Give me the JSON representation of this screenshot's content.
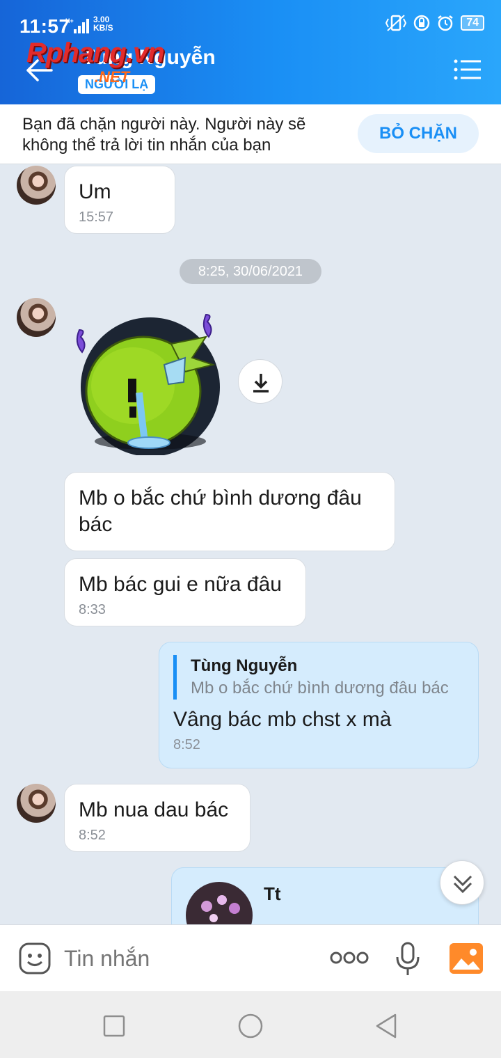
{
  "status_bar": {
    "time": "11:57",
    "network_type": "H+",
    "speed_value": "3.00",
    "speed_unit": "KB/S",
    "battery": "74"
  },
  "header": {
    "watermark_logo": "Rphang.vn",
    "watermark_sub": ".NET",
    "contact_name": "Tùng Nguyễn",
    "stranger_badge": "NGƯỜI LẠ"
  },
  "block_banner": {
    "text": "Bạn đã chặn người này. Người này sẽ không thể trả lời tin nhắn của bạn",
    "unblock_label": "BỎ CHẶN"
  },
  "chat": {
    "date_separator": "8:25, 30/06/2021",
    "messages": [
      {
        "text": "Um",
        "time": "15:57"
      },
      {
        "text": "Mb o bắc chứ bình dương đâu bác"
      },
      {
        "text": "Mb bác gui e nữa đâu",
        "time": "8:33"
      },
      {
        "quote_name": "Tùng Nguyễn",
        "quote_text": "Mb o bắc chứ bình dương đâu bác",
        "text": "Vâng bác mb chst x mà",
        "time": "8:52"
      },
      {
        "text": "Mb nua dau bác",
        "time": "8:52"
      },
      {
        "text": "Tt"
      }
    ]
  },
  "input_bar": {
    "placeholder": "Tin nhắn"
  },
  "colors": {
    "accent": "#1a8ff5",
    "header_start": "#1665d8",
    "chat_bg": "#e2e9f1",
    "my_bubble": "#d5ecfd"
  }
}
